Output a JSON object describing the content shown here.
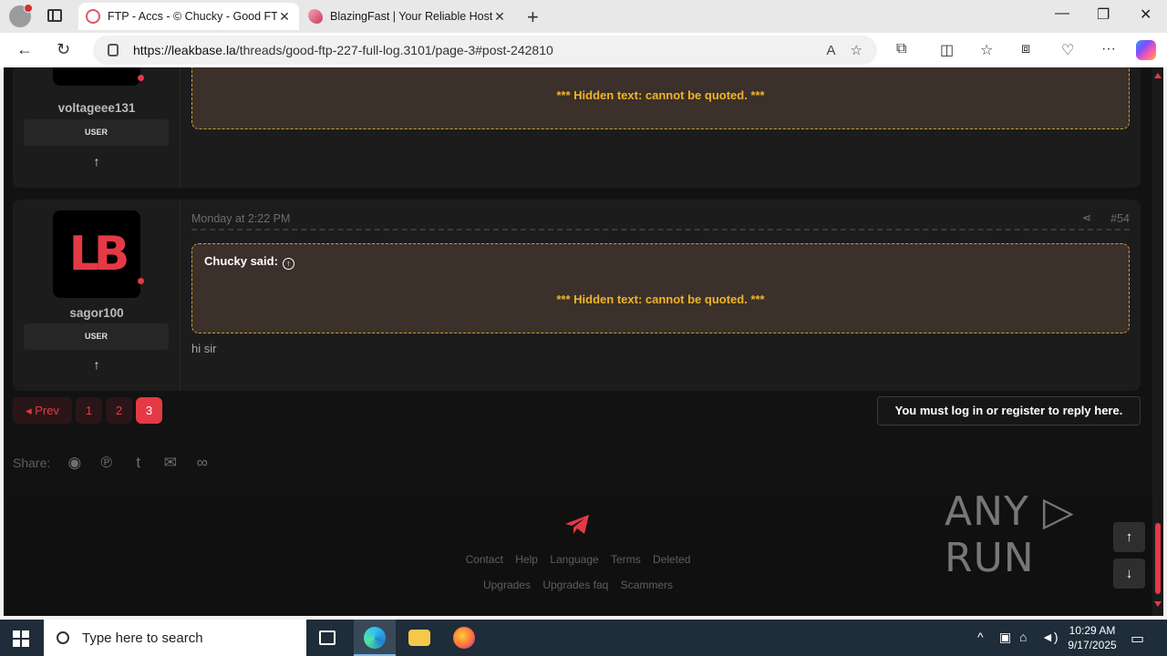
{
  "browser": {
    "tabs": [
      {
        "title": "FTP - Accs - © Chucky - Good FTP",
        "close": "✕"
      },
      {
        "title": "BlazingFast | Your Reliable Hosting",
        "close": "✕"
      }
    ],
    "new_tab": "+",
    "window_controls": {
      "minimize": "—",
      "restore": "❐",
      "close": "✕"
    },
    "url_host": "https://leakbase.la",
    "url_path": "/threads/good-ftp-227-full-log.3101/page-3#post-242810",
    "read_aloud": "A",
    "favorite": "☆"
  },
  "post1": {
    "username": "voltageee131",
    "role": "USER",
    "hidden_text": "*** Hidden text: cannot be quoted. ***"
  },
  "post2": {
    "date": "Monday at 2:22 PM",
    "number": "#54",
    "avatar_text": "LB",
    "username": "sagor100",
    "role": "USER",
    "quote_author": "Chucky said:",
    "hidden_text": "*** Hidden text: cannot be quoted. ***",
    "body": "hi sir"
  },
  "pagination": {
    "prev": "◂ Prev",
    "pages": [
      "1",
      "2",
      "3"
    ],
    "current": "3"
  },
  "reply_notice": "You must log in or register to reply here.",
  "share": {
    "label": "Share:",
    "icons": [
      "reddit-icon",
      "pinterest-icon",
      "tumblr-icon",
      "email-icon",
      "link-icon"
    ]
  },
  "footer": {
    "links_row1": [
      "Contact",
      "Help",
      "Language",
      "Terms",
      "Deleted"
    ],
    "links_row2": [
      "Upgrades",
      "Upgrades faq",
      "Scammers"
    ]
  },
  "watermark": "ANY ▷ RUN",
  "taskbar": {
    "search_placeholder": "Type here to search",
    "time": "10:29 AM",
    "date": "9/17/2025"
  },
  "colors": {
    "accent": "#e53946",
    "quote_border": "#c9a32d",
    "hidden_text": "#f0b429",
    "page_bg": "#121212"
  }
}
